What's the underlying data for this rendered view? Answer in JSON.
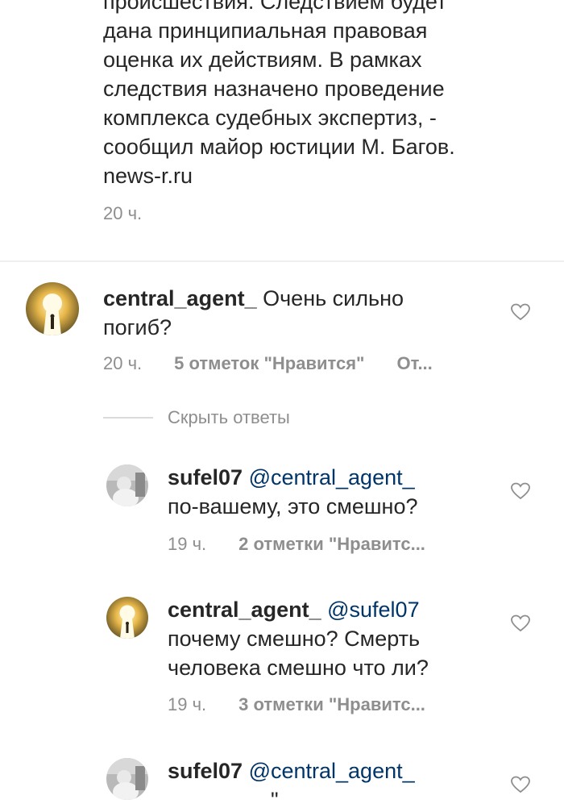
{
  "caption": {
    "text": "происшествия. Следствием будет\nдана принципиальная правовая\nоценка их действиям. В рамках\nследствия назначено проведение\nкомплекса судебных экспертиз, -\nсообщил майор юстиции М. Багов.\nnews-r.ru",
    "time": "20 ч."
  },
  "comments": [
    {
      "username": "central_agent_",
      "mention": "",
      "text_line1": "Очень сильно",
      "text_line2": "погиб?",
      "time": "20 ч.",
      "likes": "5 отметок \"Нравится\"",
      "reply": "От..."
    },
    {
      "username": "sufel07",
      "mention": "@central_agent_",
      "text_line1": "по-вашему, это смешно?",
      "text_line2": "",
      "time": "19 ч.",
      "likes": "2 отметки \"Нравитс...",
      "reply": ""
    },
    {
      "username": "central_agent_",
      "mention": "@sufel07",
      "text_line1": "почему смешно? Смерть",
      "text_line2": "человека смешно что ли?",
      "time": "19 ч.",
      "likes": "3 отметки \"Нравитс...",
      "reply": ""
    },
    {
      "username": "sufel07",
      "mention": "@central_agent_",
      "text_line1": "\"",
      "text_line2": "",
      "time": "",
      "likes": "",
      "reply": ""
    }
  ],
  "hide_replies_label": "Скрыть ответы",
  "icons": {
    "like": "heart-icon"
  },
  "colors": {
    "text": "#262626",
    "meta": "#8e8e8e",
    "mention": "#003569",
    "divider": "#efefef"
  }
}
